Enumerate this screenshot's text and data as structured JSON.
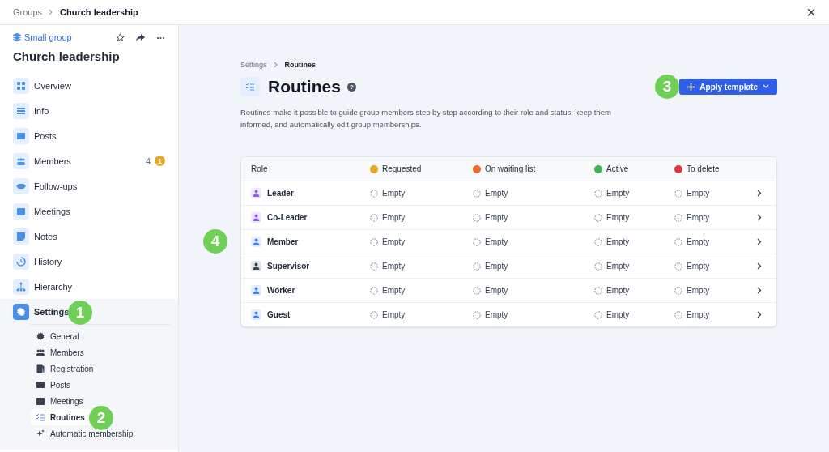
{
  "topbar": {
    "breadcrumb": [
      "Groups",
      "Church leadership"
    ],
    "close": "×"
  },
  "sidebar": {
    "group_type": "Small group",
    "title": "Church leadership",
    "items": [
      {
        "label": "Overview",
        "selected": false
      },
      {
        "label": "Info",
        "selected": false
      },
      {
        "label": "Posts",
        "selected": false
      },
      {
        "label": "Members",
        "selected": false,
        "count": "4",
        "badge": "1"
      },
      {
        "label": "Follow-ups",
        "selected": false
      },
      {
        "label": "Meetings",
        "selected": false
      },
      {
        "label": "Notes",
        "selected": false
      },
      {
        "label": "History",
        "selected": false
      },
      {
        "label": "Hierarchy",
        "selected": false
      },
      {
        "label": "Settings",
        "selected": true,
        "expanded": true,
        "children": [
          {
            "label": "General",
            "selected": false
          },
          {
            "label": "Members",
            "selected": false
          },
          {
            "label": "Registration",
            "selected": false
          },
          {
            "label": "Posts",
            "selected": false
          },
          {
            "label": "Meetings",
            "selected": false
          },
          {
            "label": "Routines",
            "selected": true
          },
          {
            "label": "Automatic membership",
            "selected": false
          }
        ]
      }
    ]
  },
  "main": {
    "breadcrumb": [
      "Settings",
      "Routines"
    ],
    "title": "Routines",
    "help": "?",
    "description": "Routines make it possible to guide group members step by step according to their role and status, keep them informed, and automatically edit group memberships.",
    "apply_button": "Apply template",
    "table": {
      "columns": [
        {
          "label": "Role"
        },
        {
          "label": "Requested",
          "color": "#e5a823"
        },
        {
          "label": "On waiting list",
          "color": "#ee6c2b"
        },
        {
          "label": "Active",
          "color": "#3fb350"
        },
        {
          "label": "To delete",
          "color": "#e03a3e"
        }
      ],
      "rows": [
        {
          "color": "#8b5cf6",
          "cells": [
            "Leader",
            "Empty",
            "Empty",
            "Empty",
            "Empty"
          ]
        },
        {
          "color": "#8b5cf6",
          "cells": [
            "Co-Leader",
            "Empty",
            "Empty",
            "Empty",
            "Empty"
          ]
        },
        {
          "color": "#3b82f6",
          "cells": [
            "Member",
            "Empty",
            "Empty",
            "Empty",
            "Empty"
          ]
        },
        {
          "color": "#374151",
          "cells": [
            "Supervisor",
            "Empty",
            "Empty",
            "Empty",
            "Empty"
          ]
        },
        {
          "color": "#3b82f6",
          "cells": [
            "Worker",
            "Empty",
            "Empty",
            "Empty",
            "Empty"
          ]
        },
        {
          "color": "#3b82f6",
          "cells": [
            "Guest",
            "Empty",
            "Empty",
            "Empty",
            "Empty"
          ]
        }
      ]
    }
  },
  "callouts": [
    "1",
    "2",
    "3",
    "4"
  ]
}
